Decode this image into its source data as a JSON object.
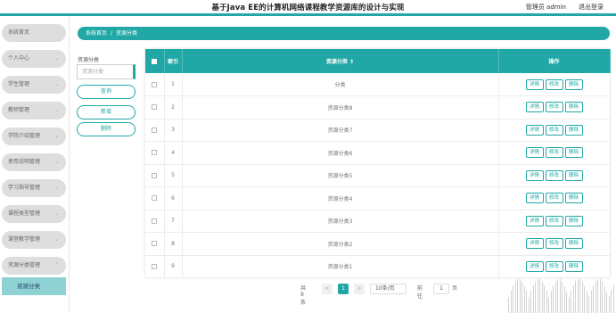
{
  "header": {
    "title": "基于Java EE的计算机网络课程教学资源库的设计与实现",
    "user_label": "管理员 admin",
    "logout_label": "退出登录"
  },
  "colors": {
    "accent": "#21a8a6",
    "sidebar_item": "#dedede",
    "sidebar_active": "#8fd2d3"
  },
  "sidebar": {
    "items": [
      {
        "label": "系统首页",
        "icon": ""
      },
      {
        "label": "个人中心",
        "icon": "chevron-down-icon"
      },
      {
        "label": "学生管理",
        "icon": "chevron-down-icon"
      },
      {
        "label": "教师管理",
        "icon": "chevron-down-icon"
      },
      {
        "label": "学院介绍管理",
        "icon": "chevron-down-icon"
      },
      {
        "label": "使用说明管理",
        "icon": "chevron-down-icon"
      },
      {
        "label": "学习指导管理",
        "icon": "chevron-down-icon"
      },
      {
        "label": "课程类型管理",
        "icon": "chevron-down-icon"
      },
      {
        "label": "课堂教学管理",
        "icon": "chevron-down-icon"
      },
      {
        "label": "资源分类管理",
        "icon": "chevron-up-icon"
      }
    ],
    "active_sub": "资源分类"
  },
  "breadcrumb": {
    "home": "系统首页",
    "separator": "/",
    "current": "资源分类"
  },
  "filter": {
    "label": "资源分类",
    "placeholder": "资源分类",
    "search_button": "查询",
    "add_button": "新增",
    "delete_button": "删除"
  },
  "table": {
    "columns": {
      "index": "索引",
      "name": "资源分类",
      "sort_icon": "⇕",
      "actions": "操作"
    },
    "action_labels": {
      "detail": "详情",
      "edit": "修改",
      "delete": "删除"
    },
    "rows": [
      {
        "index": "1",
        "name": "分类"
      },
      {
        "index": "2",
        "name": "资源分类8"
      },
      {
        "index": "3",
        "name": "资源分类7"
      },
      {
        "index": "4",
        "name": "资源分类6"
      },
      {
        "index": "5",
        "name": "资源分类5"
      },
      {
        "index": "6",
        "name": "资源分类4"
      },
      {
        "index": "7",
        "name": "资源分类3"
      },
      {
        "index": "8",
        "name": "资源分类2"
      },
      {
        "index": "9",
        "name": "资源分类1"
      }
    ]
  },
  "pagination": {
    "total": "共 9 条",
    "prev": "<",
    "current_page": "1",
    "next": ">",
    "page_size": "10条/页",
    "goto_prefix": "前往",
    "goto_value": "1",
    "goto_suffix": "页"
  }
}
